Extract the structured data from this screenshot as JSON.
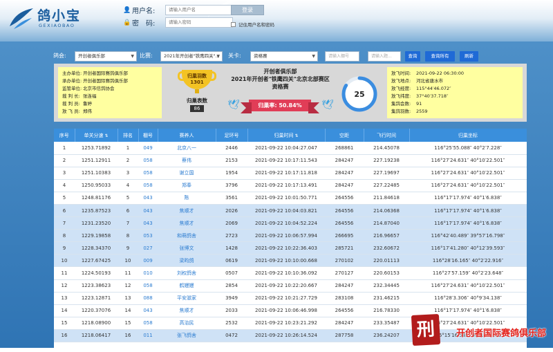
{
  "header": {
    "logo_text": "鸽小宝",
    "logo_sub": "GEXIAOBAO",
    "username_label": "用户名:",
    "username_placeholder": "请输入用户名",
    "password_label": "密　码:",
    "password_placeholder": "请输入密码",
    "login_button": "登录",
    "remember_label": "记住用户名和密码"
  },
  "filter": {
    "pigeon_club_label": "鸽会:",
    "pigeon_club_value": "开创者俱乐部",
    "race_label": "比赛:",
    "race_value": "2021年开创者\"铁鹰四关\"...",
    "stage_label": "关卡:",
    "stage_value": "资格赛",
    "ring_placeholder": "请输入棚号",
    "keyword_placeholder": "请输入题...",
    "query_button": "查询",
    "query_all_button": "查询所有",
    "refresh_button": "刷新"
  },
  "info": {
    "left": [
      {
        "k": "主办单位:",
        "v": "开创者国际赛鸽俱乐部"
      },
      {
        "k": "承办单位:",
        "v": "开创者国际赛鸽俱乐部"
      },
      {
        "k": "监管单位:",
        "v": "北京市信鸽协会"
      },
      {
        "k": "裁  判 长:",
        "v": "张连福"
      },
      {
        "k": "裁  判 员:",
        "v": "鲁婷"
      },
      {
        "k": "放  飞 员:",
        "v": "郑伟"
      }
    ],
    "trophy_line1": "归巢羽数",
    "trophy_count": "1301",
    "trophy_line2": "归巢表数",
    "trophy_sub": "86",
    "club": "开创者俱乐部",
    "race": "2021年开创者\"铁鹰四关\"北京北部赛区",
    "qual": "资格赛",
    "rate_label": "归巢率: 50.84%",
    "ring_value": "25",
    "ring_fraction": 0.84,
    "right": [
      {
        "k": "放飞时间:",
        "v": "2021-09-22 06:30:00"
      },
      {
        "k": "放飞地点:",
        "v": "河北省唐水市"
      },
      {
        "k": "放飞经度:",
        "v": "115°44′46.072″"
      },
      {
        "k": "放飞纬度:",
        "v": "37°40′37.718″"
      },
      {
        "k": "集鸽会数:",
        "v": "91"
      },
      {
        "k": "集鸽羽数:",
        "v": "2559"
      }
    ]
  },
  "table": {
    "headers": [
      "序号",
      "单关分速",
      "排名",
      "棚号",
      "赛养人",
      "足环号",
      "归巢时间",
      "空距",
      "飞行时间",
      "归巢坐标"
    ],
    "rows": [
      [
        "1",
        "1253.71892",
        "1",
        "049",
        "北京八一",
        "2446",
        "2021-09-22 10:04:27.047",
        "268861",
        "214.45078",
        "116°25′55.088″ 40°2′7.228″"
      ],
      [
        "2",
        "1251.12911",
        "2",
        "058",
        "蔡伟",
        "2153",
        "2021-09-22 10:17:11.543",
        "284247",
        "227.19238",
        "116°27′24.631″ 40°10′22.501″"
      ],
      [
        "3",
        "1251.10383",
        "3",
        "058",
        "谢立国",
        "1954",
        "2021-09-22 10:17:11.818",
        "284247",
        "227.19697",
        "116°27′24.631″ 40°10′22.501″"
      ],
      [
        "4",
        "1250.95033",
        "4",
        "058",
        "郑奉",
        "3796",
        "2021-09-22 10:17:13.491",
        "284247",
        "227.22485",
        "116°27′24.631″ 40°10′22.501″"
      ],
      [
        "5",
        "1248.81176",
        "5",
        "043",
        "陈",
        "3561",
        "2021-09-22 10:01:50.771",
        "264556",
        "211.84618",
        "116°17′17.974″ 40°1′6.838″"
      ],
      [
        "6",
        "1235.87523",
        "6",
        "043",
        "焦顺才",
        "2026",
        "2021-09-22 10:04:03.821",
        "264556",
        "214.06368",
        "116°17′17.974″ 40°1′6.838″"
      ],
      [
        "7",
        "1231.23520",
        "7",
        "043",
        "焦顺才",
        "2069",
        "2021-09-22 10:04:52.224",
        "264556",
        "214.87040",
        "116°17′17.974″ 40°1′6.838″"
      ],
      [
        "8",
        "1229.19858",
        "8",
        "053",
        "和萌鸽舍",
        "2723",
        "2021-09-22 10:06:57.994",
        "266695",
        "216.96657",
        "116°42′40.489″ 39°57′16.798″"
      ],
      [
        "9",
        "1228.34370",
        "9",
        "027",
        "张博文",
        "1428",
        "2021-09-22 10:22:36.403",
        "285721",
        "232.60672",
        "116°17′41.280″ 40°12′39.593″"
      ],
      [
        "10",
        "1227.67425",
        "10",
        "009",
        "梁昀鸽",
        "0619",
        "2021-09-22 10:10:00.668",
        "270102",
        "220.01113",
        "116°28′16.165″ 40°2′22.916″"
      ],
      [
        "11",
        "1224.50193",
        "11",
        "010",
        "刘权鸽舍",
        "0507",
        "2021-09-22 10:10:36.092",
        "270127",
        "220.60153",
        "116°27′57.159″ 40°2′23.648″"
      ],
      [
        "12",
        "1223.38623",
        "12",
        "058",
        "鹤嫚嫚",
        "2854",
        "2021-09-22 10:22:20.667",
        "284247",
        "232.34445",
        "116°27′24.631″ 40°10′22.501″"
      ],
      [
        "13",
        "1223.12871",
        "13",
        "088",
        "平安滋家",
        "3949",
        "2021-09-22 10:21:27.729",
        "283108",
        "231.46215",
        "116°28′3.306″ 40°9′34.138″"
      ],
      [
        "14",
        "1220.37076",
        "14",
        "043",
        "焦顺才",
        "2033",
        "2021-09-22 10:06:46.998",
        "264556",
        "216.78330",
        "116°17′17.974″ 40°1′6.838″"
      ],
      [
        "15",
        "1218.08900",
        "15",
        "058",
        "高治民",
        "2532",
        "2021-09-22 10:23:21.292",
        "284247",
        "233.35487",
        "116°27′24.631″ 40°10′22.501″"
      ],
      [
        "16",
        "1218.06417",
        "16",
        "011",
        "张飞鸽舍",
        "0472",
        "2021-09-22 10:26:14.524",
        "287758",
        "236.24207",
        "116°15′16.585″ 40°14′4.592″"
      ]
    ],
    "highlight_rows": [
      6,
      7,
      8,
      9,
      10,
      16
    ]
  },
  "watermark": {
    "seal": "刑",
    "text": "开创者国际赛鸽俱乐部"
  },
  "colors": {
    "accent": "#1f6ad6",
    "header_row": "#3a8fdc",
    "highlight": "#cfe2f6",
    "ring": "#3b8de0"
  }
}
